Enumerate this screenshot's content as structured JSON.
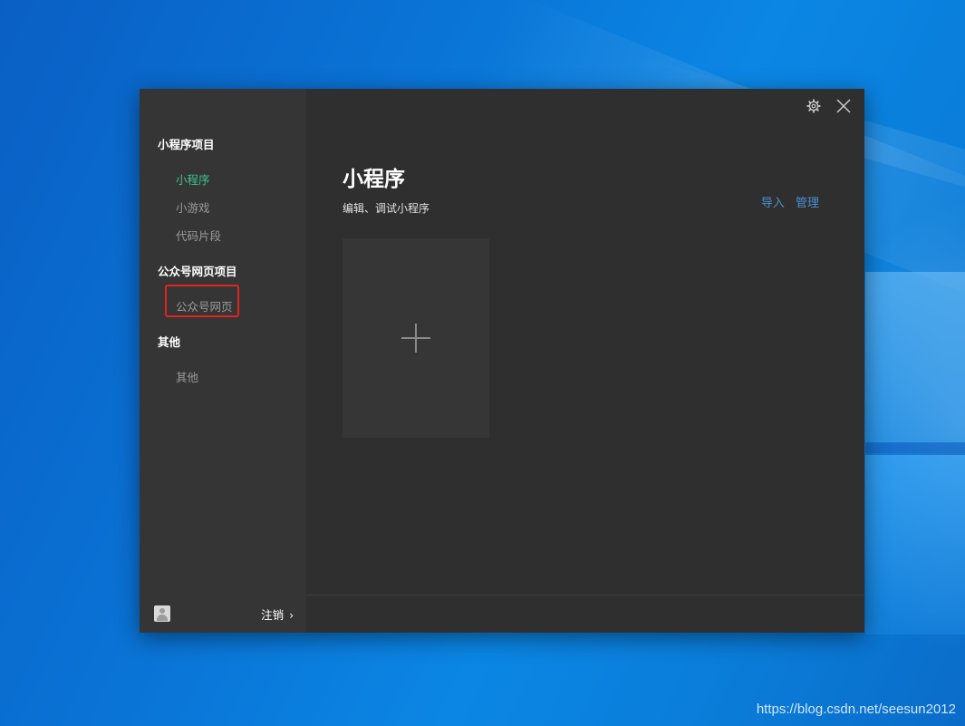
{
  "window": {
    "sidebar": {
      "sections": [
        {
          "title": "小程序项目",
          "items": [
            "小程序",
            "小游戏",
            "代码片段"
          ]
        },
        {
          "title": "公众号网页项目",
          "items": [
            "公众号网页"
          ]
        },
        {
          "title": "其他",
          "items": [
            "其他"
          ]
        }
      ],
      "active_item": "小程序",
      "highlighted_item": "公众号网页",
      "logout_label": "注销",
      "logout_chevron": "›"
    },
    "header": {
      "title": "小程序",
      "subtitle": "编辑、调试小程序",
      "actions": {
        "import": "导入",
        "manage": "管理"
      }
    },
    "new_project": {
      "icon": "plus-icon"
    },
    "top_icons": [
      "gear-icon",
      "close-icon"
    ]
  },
  "colors": {
    "active": "#3cc48e",
    "link": "#4a8fd0",
    "highlight_border": "#e0241c",
    "window_bg": "#2f2f2f",
    "sidebar_bg": "#353535"
  },
  "watermark": "https://blog.csdn.net/seesun2012"
}
